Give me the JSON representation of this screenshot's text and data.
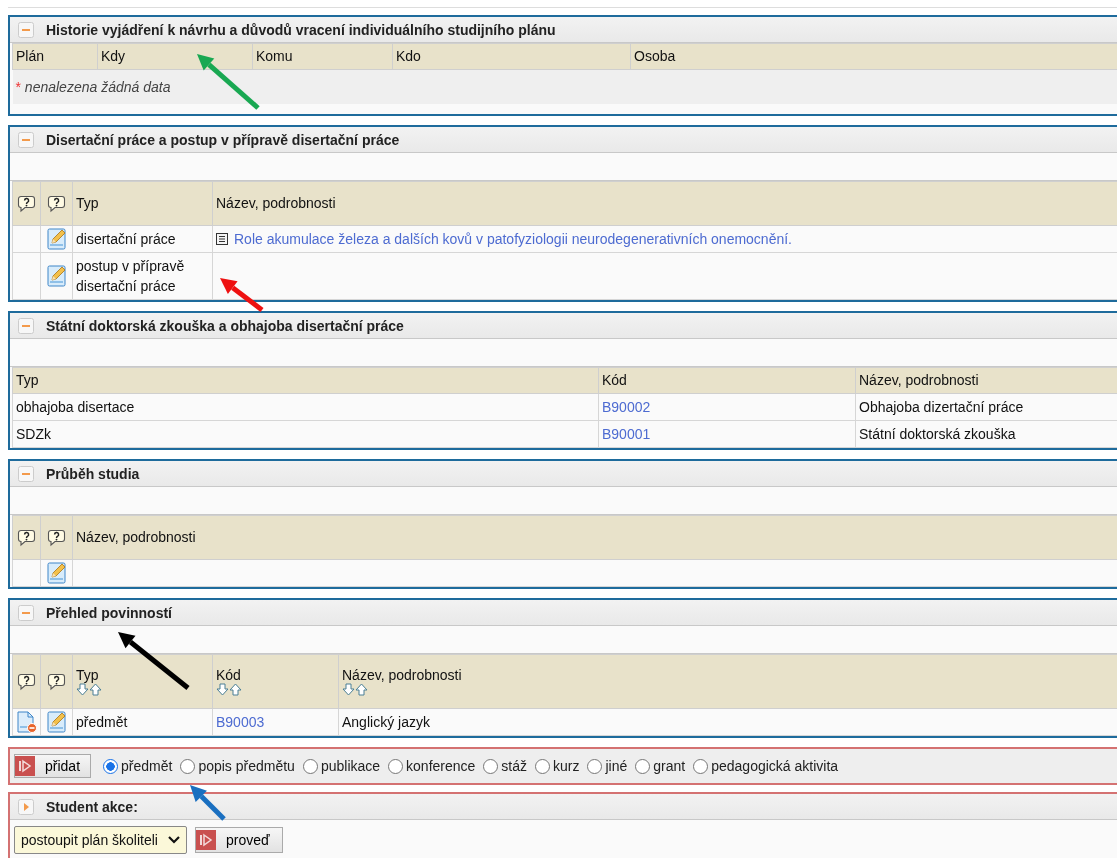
{
  "sections": [
    {
      "kind": "history",
      "title": "Historie vyjádření k návrhu a důvodů vracení individuálního studijního plánu",
      "expanded": true,
      "columns": [
        {
          "kind": "text",
          "label": "Plán"
        },
        {
          "kind": "text",
          "label": "Kdy"
        },
        {
          "kind": "text",
          "label": "Komu"
        },
        {
          "kind": "text",
          "label": "Kdo"
        },
        {
          "kind": "text",
          "label": "Osoba"
        }
      ],
      "note": {
        "mark": "*",
        "text": "nenalezena žádná data"
      }
    },
    {
      "kind": "thesis",
      "title": "Disertační práce a postup v přípravě disertační práce",
      "expanded": true,
      "columns": [
        {
          "kind": "help"
        },
        {
          "kind": "help"
        },
        {
          "kind": "text",
          "label": "Typ"
        },
        {
          "kind": "text",
          "label": "Název, podrobnosti"
        }
      ],
      "rows": [
        [
          {
            "kind": "empty"
          },
          {
            "kind": "edit"
          },
          {
            "kind": "text",
            "text": "disertační práce"
          },
          {
            "kind": "doc-link",
            "text": "Role akumulace železa a dalších kovů v patofyziologii neurodegenerativních onemocnění."
          }
        ],
        [
          {
            "kind": "empty"
          },
          {
            "kind": "edit"
          },
          {
            "kind": "text",
            "text": "postup v přípravě disertační práce"
          },
          {
            "kind": "empty"
          }
        ]
      ]
    },
    {
      "kind": "exam",
      "title": "Státní doktorská zkouška a obhajoba disertační práce",
      "expanded": true,
      "columns": [
        {
          "kind": "text",
          "label": "Typ"
        },
        {
          "kind": "text",
          "label": "Kód"
        },
        {
          "kind": "text",
          "label": "Název, podrobnosti"
        }
      ],
      "rows": [
        [
          {
            "kind": "text",
            "text": "obhajoba disertace"
          },
          {
            "kind": "link",
            "text": "B90002"
          },
          {
            "kind": "text",
            "text": "Obhajoba dizertační práce"
          }
        ],
        [
          {
            "kind": "text",
            "text": "SDZk"
          },
          {
            "kind": "link",
            "text": "B90001"
          },
          {
            "kind": "text",
            "text": "Státní doktorská zkouška"
          }
        ]
      ]
    },
    {
      "kind": "progress",
      "title": "Průběh studia",
      "expanded": true,
      "columns": [
        {
          "kind": "help"
        },
        {
          "kind": "help"
        },
        {
          "kind": "text",
          "label": "Název, podrobnosti"
        }
      ],
      "rows": [
        [
          {
            "kind": "empty"
          },
          {
            "kind": "edit"
          },
          {
            "kind": "empty"
          }
        ]
      ]
    },
    {
      "kind": "duties",
      "title": "Přehled povinností",
      "expanded": true,
      "columns": [
        {
          "kind": "help"
        },
        {
          "kind": "help"
        },
        {
          "kind": "text",
          "label": "Typ",
          "sortable": true
        },
        {
          "kind": "text",
          "label": "Kód",
          "sortable": true
        },
        {
          "kind": "text",
          "label": "Název, podrobnosti",
          "sortable": true
        }
      ],
      "rows": [
        [
          {
            "kind": "remove"
          },
          {
            "kind": "edit"
          },
          {
            "kind": "text",
            "text": "předmět"
          },
          {
            "kind": "link",
            "text": "B90003"
          },
          {
            "kind": "text",
            "text": "Anglický jazyk"
          }
        ]
      ]
    }
  ],
  "add_bar": {
    "button": "přidat",
    "options": [
      {
        "label": "předmět",
        "selected": true
      },
      {
        "label": "popis předmětu",
        "selected": false
      },
      {
        "label": "publikace",
        "selected": false
      },
      {
        "label": "konference",
        "selected": false
      },
      {
        "label": "stáž",
        "selected": false
      },
      {
        "label": "kurz",
        "selected": false
      },
      {
        "label": "jiné",
        "selected": false
      },
      {
        "label": "grant",
        "selected": false
      },
      {
        "label": "pedagogická aktivita",
        "selected": false
      }
    ]
  },
  "student_action": {
    "title": "Student akce:",
    "expanded": false,
    "select_value": "postoupit plán školiteli",
    "button": "proveď"
  },
  "annotations": [
    {
      "color": "#19a852"
    },
    {
      "color": "#ee1111"
    },
    {
      "color": "#000000"
    },
    {
      "color": "#1a6fc0"
    }
  ]
}
